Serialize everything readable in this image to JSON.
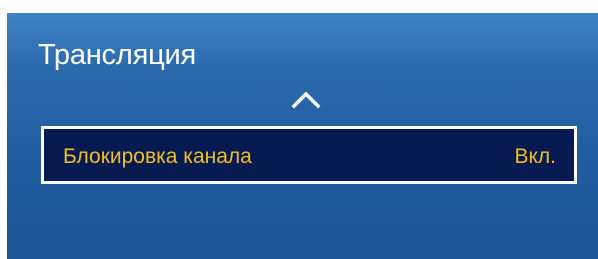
{
  "panel": {
    "title": "Трансляция",
    "scroll_up_icon": "chevron-up-icon"
  },
  "menu": {
    "items": [
      {
        "label": "Блокировка канала",
        "value": "Вкл.",
        "selected": true
      }
    ]
  },
  "colors": {
    "panel_background": "#215ea1",
    "panel_text": "#ffffff",
    "selected_row_background": "#061a52",
    "selected_row_border": "#ffffff",
    "selected_text": "#f3be1c"
  }
}
